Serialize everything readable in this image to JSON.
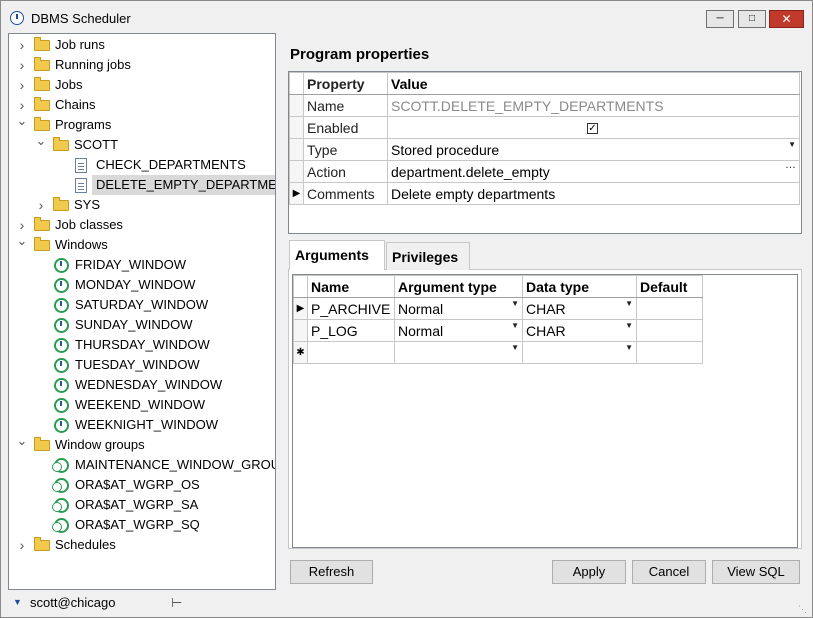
{
  "window": {
    "title": "DBMS Scheduler"
  },
  "tree": [
    {
      "label": "Job runs",
      "level": 0,
      "icon": "folder-icon",
      "expander": "collapsed"
    },
    {
      "label": "Running jobs",
      "level": 0,
      "icon": "folder-icon",
      "expander": "collapsed"
    },
    {
      "label": "Jobs",
      "level": 0,
      "icon": "folder-icon",
      "expander": "collapsed"
    },
    {
      "label": "Chains",
      "level": 0,
      "icon": "folder-icon",
      "expander": "collapsed"
    },
    {
      "label": "Programs",
      "level": 0,
      "icon": "folder-icon",
      "expander": "expanded"
    },
    {
      "label": "SCOTT",
      "level": 1,
      "icon": "folder-icon",
      "expander": "expanded"
    },
    {
      "label": "CHECK_DEPARTMENTS",
      "level": 2,
      "icon": "program-icon",
      "expander": "none"
    },
    {
      "label": "DELETE_EMPTY_DEPARTMENTS",
      "level": 2,
      "icon": "program-icon",
      "expander": "none",
      "selected": true
    },
    {
      "label": "SYS",
      "level": 1,
      "icon": "folder-icon",
      "expander": "collapsed"
    },
    {
      "label": "Job classes",
      "level": 0,
      "icon": "folder-icon",
      "expander": "collapsed"
    },
    {
      "label": "Windows",
      "level": 0,
      "icon": "folder-icon",
      "expander": "expanded"
    },
    {
      "label": "FRIDAY_WINDOW",
      "level": 1,
      "icon": "clock-icon",
      "expander": "none"
    },
    {
      "label": "MONDAY_WINDOW",
      "level": 1,
      "icon": "clock-icon",
      "expander": "none"
    },
    {
      "label": "SATURDAY_WINDOW",
      "level": 1,
      "icon": "clock-icon",
      "expander": "none"
    },
    {
      "label": "SUNDAY_WINDOW",
      "level": 1,
      "icon": "clock-icon",
      "expander": "none"
    },
    {
      "label": "THURSDAY_WINDOW",
      "level": 1,
      "icon": "clock-icon",
      "expander": "none"
    },
    {
      "label": "TUESDAY_WINDOW",
      "level": 1,
      "icon": "clock-icon",
      "expander": "none"
    },
    {
      "label": "WEDNESDAY_WINDOW",
      "level": 1,
      "icon": "clock-icon",
      "expander": "none"
    },
    {
      "label": "WEEKEND_WINDOW",
      "level": 1,
      "icon": "clock-icon",
      "expander": "none"
    },
    {
      "label": "WEEKNIGHT_WINDOW",
      "level": 1,
      "icon": "clock-icon",
      "expander": "none"
    },
    {
      "label": "Window groups",
      "level": 0,
      "icon": "folder-icon",
      "expander": "expanded"
    },
    {
      "label": "MAINTENANCE_WINDOW_GROUP",
      "level": 1,
      "icon": "window-group-icon",
      "expander": "none"
    },
    {
      "label": "ORA$AT_WGRP_OS",
      "level": 1,
      "icon": "window-group-icon",
      "expander": "none"
    },
    {
      "label": "ORA$AT_WGRP_SA",
      "level": 1,
      "icon": "window-group-icon",
      "expander": "none"
    },
    {
      "label": "ORA$AT_WGRP_SQ",
      "level": 1,
      "icon": "window-group-icon",
      "expander": "none"
    },
    {
      "label": "Schedules",
      "level": 0,
      "icon": "folder-icon",
      "expander": "collapsed"
    }
  ],
  "status": {
    "connection": "scott@chicago"
  },
  "program_properties": {
    "title": "Program properties",
    "header_property": "Property",
    "header_value": "Value",
    "rows": [
      {
        "name": "Name",
        "value": "SCOTT.DELETE_EMPTY_DEPARTMENTS"
      },
      {
        "name": "Enabled",
        "value": "✓"
      },
      {
        "name": "Type",
        "value": "Stored procedure"
      },
      {
        "name": "Action",
        "value": "department.delete_empty"
      },
      {
        "name": "Comments",
        "value": "Delete empty departments"
      }
    ]
  },
  "tabs": {
    "arguments": "Arguments",
    "privileges": "Privileges"
  },
  "arguments": {
    "headers": [
      "Name",
      "Argument type",
      "Data type",
      "Default"
    ],
    "rows": [
      [
        "P_ARCHIVE",
        "Normal",
        "CHAR",
        ""
      ],
      [
        "P_LOG",
        "Normal",
        "CHAR",
        ""
      ]
    ]
  },
  "buttons": {
    "refresh": "Refresh",
    "apply": "Apply",
    "cancel": "Cancel",
    "view_sql": "View SQL"
  }
}
